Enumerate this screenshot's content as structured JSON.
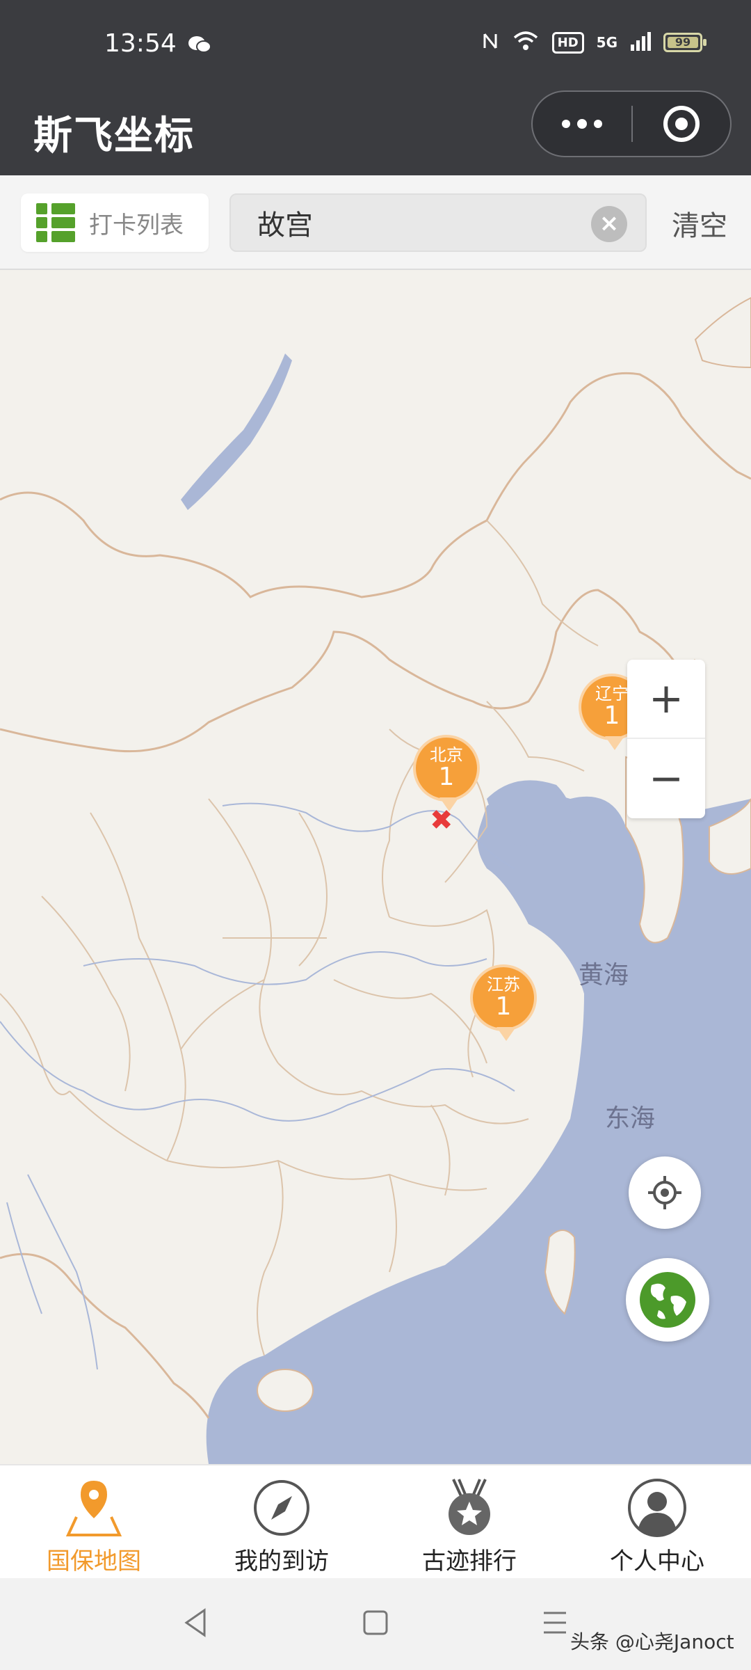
{
  "status_bar": {
    "time": "13:54",
    "network": "5G",
    "hd": "HD",
    "battery": "99"
  },
  "header": {
    "title": "斯飞坐标"
  },
  "toolbar": {
    "list_label": "打卡列表",
    "search_value": "故宫",
    "clear_label": "清空"
  },
  "map": {
    "sea_labels": [
      "黄海",
      "东海"
    ],
    "markers": [
      {
        "name": "北京",
        "count": "1"
      },
      {
        "name": "辽宁",
        "count": "1"
      },
      {
        "name": "江苏",
        "count": "1"
      }
    ]
  },
  "tabs": [
    {
      "label": "国保地图",
      "icon": "map-pin-icon",
      "active": true
    },
    {
      "label": "我的到访",
      "icon": "compass-icon",
      "active": false
    },
    {
      "label": "古迹排行",
      "icon": "medal-star-icon",
      "active": false
    },
    {
      "label": "个人中心",
      "icon": "user-avatar-icon",
      "active": false
    }
  ],
  "watermark": "头条 @心尧Janoct",
  "colors": {
    "accent": "#f29a2c",
    "marker": "#f6a03a",
    "header": "#3b3c40",
    "sea": "#aab7d6",
    "border": "#d9b79a"
  }
}
